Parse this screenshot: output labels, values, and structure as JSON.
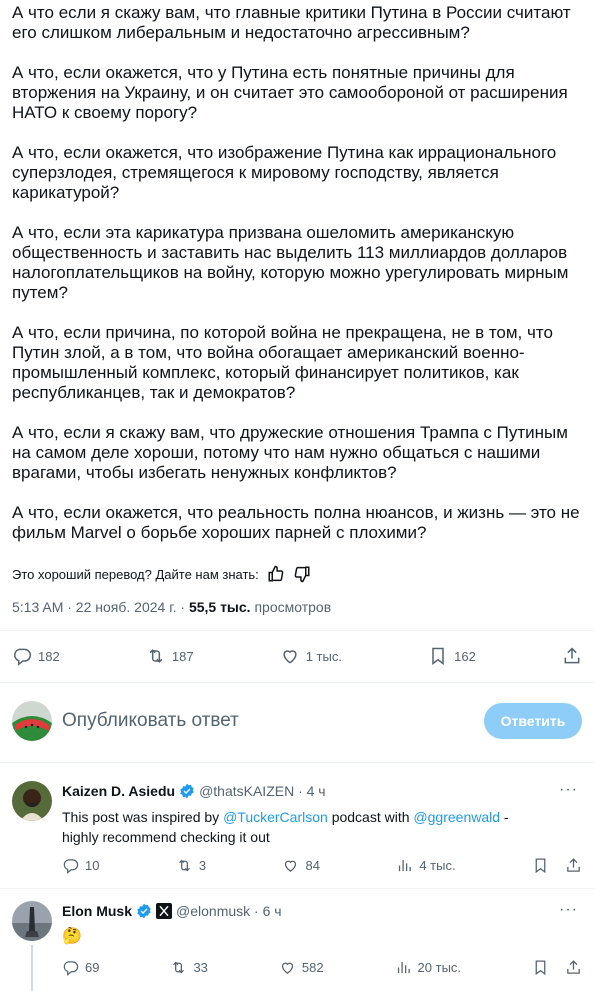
{
  "post": {
    "paragraphs": [
      "А что если я скажу вам, что главные критики Путина в России считают\nего слишком либеральным и недостаточно агрессивным?",
      "А что, если окажется, что у Путина есть понятные причины для\nвторжения на Украину, и он считает это самообороной от расширения\nНАТО к своему порогу?",
      "А что, если окажется, что изображение Путина как иррационального\nсуперзлодея, стремящегося к мировому господству, является\nкарикатурой?",
      "А что, если эта карикатура призвана ошеломить американскую\nобщественность и заставить нас выделить 113 миллиардов долларов\nналогоплательщиков на войну, которую можно урегулировать мирным\nпутем?",
      "А что, если причина, по которой война не прекращена, не в том, что\nПутин злой, а в том, что война обогащает американский военно-\nпромышленный комплекс, который финансирует политиков, как\nреспубликанцев, так и демократов?",
      "А что, если я скажу вам, что дружеские отношения Трампа с Путиным\nна самом деле хороши, потому что нам нужно общаться с нашими\nврагами, чтобы избегать ненужных конфликтов?",
      "А что, если окажется, что реальность полна нюансов, и жизнь — это не\nфильм Marvel о борьбе хороших парней с плохими?"
    ],
    "translate_prompt": "Это хороший перевод? Дайте нам знать:",
    "time": "5:13 AM · 22 нояб. 2024 г. · ",
    "views_count": "55,5 тыс.",
    "views_label": " просмотров",
    "stats": {
      "replies": "182",
      "reposts": "187",
      "likes": "1 тыс.",
      "bookmarks": "162"
    }
  },
  "compose": {
    "placeholder": "Опубликовать ответ",
    "button": "Ответить"
  },
  "replies": [
    {
      "name": "Kaizen D. Asiedu",
      "handle": "@thatsKAIZEN · 4 ч",
      "text_parts": [
        "This post was inspired by ",
        "@TuckerCarlson",
        " podcast with  ",
        "@ggreenwald",
        " -\nhighly recommend checking it out"
      ],
      "replies": "10",
      "reposts": "3",
      "likes": "84",
      "views": "4 тыс."
    },
    {
      "name": "Elon Musk",
      "handle": "@elonmusk · 6 ч",
      "text": "🤔",
      "replies": "69",
      "reposts": "33",
      "likes": "582",
      "views": "20 тыс."
    }
  ],
  "colors": {
    "accent": "#1d9bf0",
    "muted": "#536471",
    "verified": "#1d9bf0",
    "button_disabled": "#8ecdf8"
  }
}
